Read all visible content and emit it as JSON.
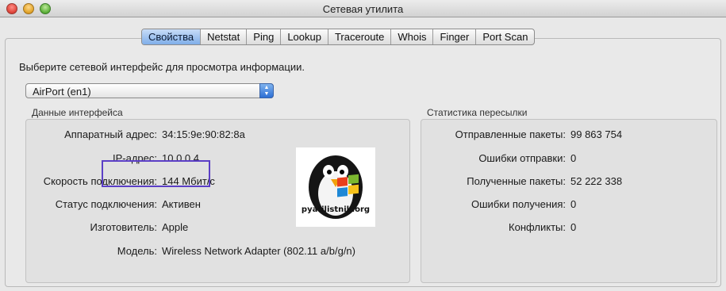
{
  "window": {
    "title": "Сетевая утилита"
  },
  "tabs": [
    {
      "label": "Свойства",
      "active": true
    },
    {
      "label": "Netstat",
      "active": false
    },
    {
      "label": "Ping",
      "active": false
    },
    {
      "label": "Lookup",
      "active": false
    },
    {
      "label": "Traceroute",
      "active": false
    },
    {
      "label": "Whois",
      "active": false
    },
    {
      "label": "Finger",
      "active": false
    },
    {
      "label": "Port Scan",
      "active": false
    }
  ],
  "interface_prompt": "Выберите сетевой интерфейс для просмотра информации.",
  "interface_select": {
    "value": "AirPort (en1)"
  },
  "interface_details": {
    "title": "Данные интерфейса",
    "rows": [
      {
        "label": "Аппаратный адрес:",
        "value": "34:15:9e:90:82:8a"
      },
      {
        "label": "IP-адрес:",
        "value": "10.0.0.4"
      },
      {
        "label": "Скорость подключения:",
        "value": "144 Мбит/с"
      },
      {
        "label": "Статус подключения:",
        "value": "Активен"
      },
      {
        "label": "Изготовитель:",
        "value": "Apple"
      },
      {
        "label": "Модель:",
        "value": "Wireless Network Adapter (802.11 a/b/g/n)"
      }
    ]
  },
  "transfer_stats": {
    "title": "Статистика пересылки",
    "rows": [
      {
        "label": "Отправленные пакеты:",
        "value": "99 863 754"
      },
      {
        "label": "Ошибки отправки:",
        "value": "0"
      },
      {
        "label": "Полученные пакеты:",
        "value": "52 222 338"
      },
      {
        "label": "Ошибки получения:",
        "value": "0"
      },
      {
        "label": "Конфликты:",
        "value": "0"
      }
    ]
  },
  "logo": {
    "text": "pyatilistnik.org",
    "icon": "penguin-windows-logo"
  },
  "colors": {
    "highlight": "#5b3fc6",
    "active_tab": "#7faee9",
    "select_arrow": "#2d6fd4"
  }
}
